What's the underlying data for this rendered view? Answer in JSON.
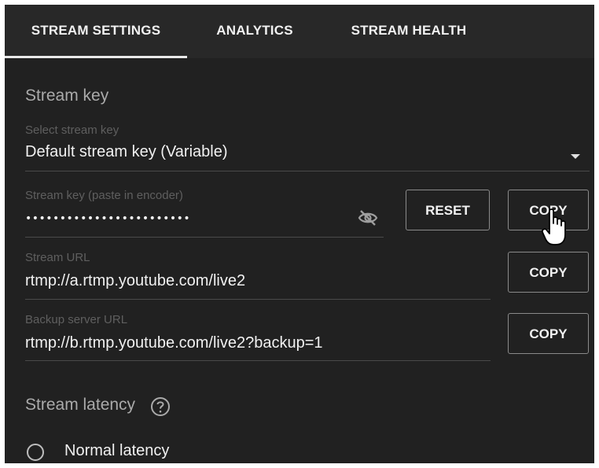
{
  "tabs": [
    {
      "label": "STREAM SETTINGS",
      "active": true
    },
    {
      "label": "ANALYTICS",
      "active": false
    },
    {
      "label": "STREAM HEALTH",
      "active": false
    }
  ],
  "stream_key": {
    "section_title": "Stream key",
    "select_label": "Select stream key",
    "select_value": "Default stream key (Variable)",
    "key_label": "Stream key (paste in encoder)",
    "key_value": "••••••••••••••••••••••••",
    "reset_label": "RESET",
    "copy_label": "COPY"
  },
  "stream_url": {
    "label": "Stream URL",
    "value": "rtmp://a.rtmp.youtube.com/live2",
    "copy_label": "COPY"
  },
  "backup_url": {
    "label": "Backup server URL",
    "value": "rtmp://b.rtmp.youtube.com/live2?backup=1",
    "copy_label": "COPY"
  },
  "latency": {
    "section_title": "Stream latency",
    "options": [
      {
        "label": "Normal latency",
        "selected": false
      }
    ]
  },
  "colors": {
    "panel_bg": "#212121",
    "tabbar_bg": "#282828",
    "text": "#f1f1f1",
    "muted": "#aaaaaa"
  },
  "icons": [
    "eye-off-icon",
    "help-circle-icon",
    "dropdown-arrow-icon",
    "hand-pointer-icon"
  ]
}
